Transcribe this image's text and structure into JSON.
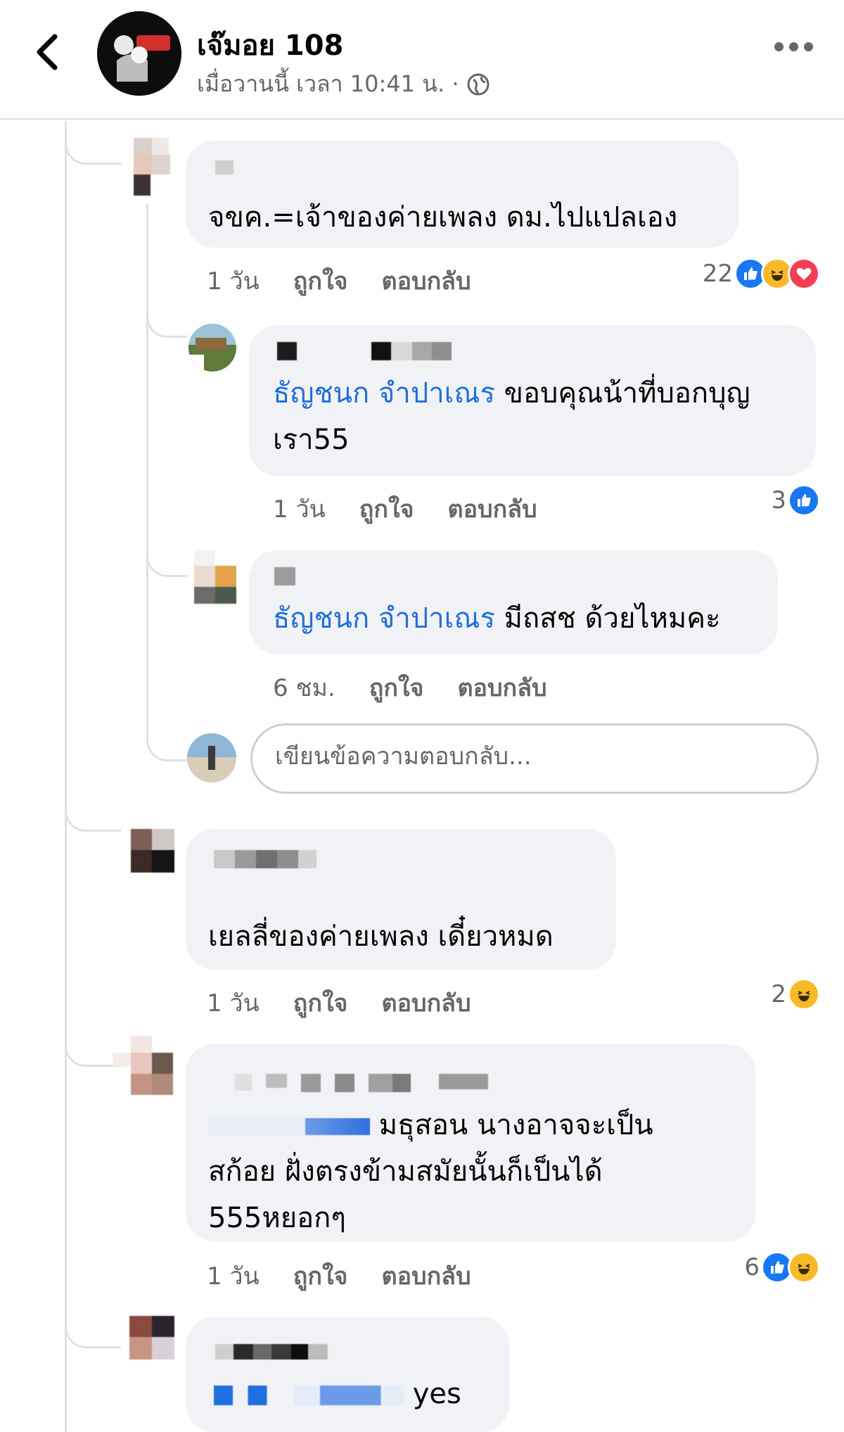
{
  "header": {
    "page_name": "เจ๊มอย 108",
    "meta": "เมื่อวานนี้ เวลา 10:41 น. ·",
    "privacy_icon": "globe-icon",
    "back_icon": "chevron-left-icon",
    "more_icon": "more-dots-icon",
    "avatar_caption": "เจ๊มอย 108"
  },
  "comments": [
    {
      "text": "จขค.=เจ้าของค่ายเพลง ดม.ไปแปลเอง",
      "time": "1 วัน",
      "like": "ถูกใจ",
      "reply": "ตอบกลับ",
      "reaction_count": "22",
      "reactions": [
        "like",
        "haha",
        "love"
      ]
    },
    {
      "mention": "ธัญชนก จำปาเณร",
      "text": " ขอบคุณน้าที่บอกบุญ",
      "text2": "เรา55",
      "time": "1 วัน",
      "like": "ถูกใจ",
      "reply": "ตอบกลับ",
      "reaction_count": "3",
      "reactions": [
        "like"
      ]
    },
    {
      "mention": "ธัญชนก จำปาเณร",
      "text": " มีถสช ด้วยไหมคะ",
      "time": "6 ชม.",
      "like": "ถูกใจ",
      "reply": "ตอบกลับ"
    },
    {
      "text": "เยลลี่ของค่ายเพลง เดี๋ยวหมด",
      "time": "1 วัน",
      "like": "ถูกใจ",
      "reply": "ตอบกลับ",
      "reaction_count": "2",
      "reactions": [
        "haha"
      ]
    },
    {
      "text": " มธุสอน นางอาจจะเป็น",
      "text2": "สก้อย ฝั่งตรงข้ามสมัยนั้นก็เป็นได้",
      "text3": "555หยอกๆ",
      "time": "1 วัน",
      "like": "ถูกใจ",
      "reply": "ตอบกลับ",
      "reaction_count": "6",
      "reactions": [
        "like",
        "haha"
      ]
    },
    {
      "text": "yes"
    }
  ],
  "reply_box": {
    "placeholder": "เขียนข้อความตอบกลับ..."
  },
  "colors": {
    "bubble": "#f0f2f5",
    "mention": "#216fdb",
    "muted": "#65676b",
    "like": "#1877f2",
    "haha": "#f7b928",
    "love": "#f33e58"
  }
}
